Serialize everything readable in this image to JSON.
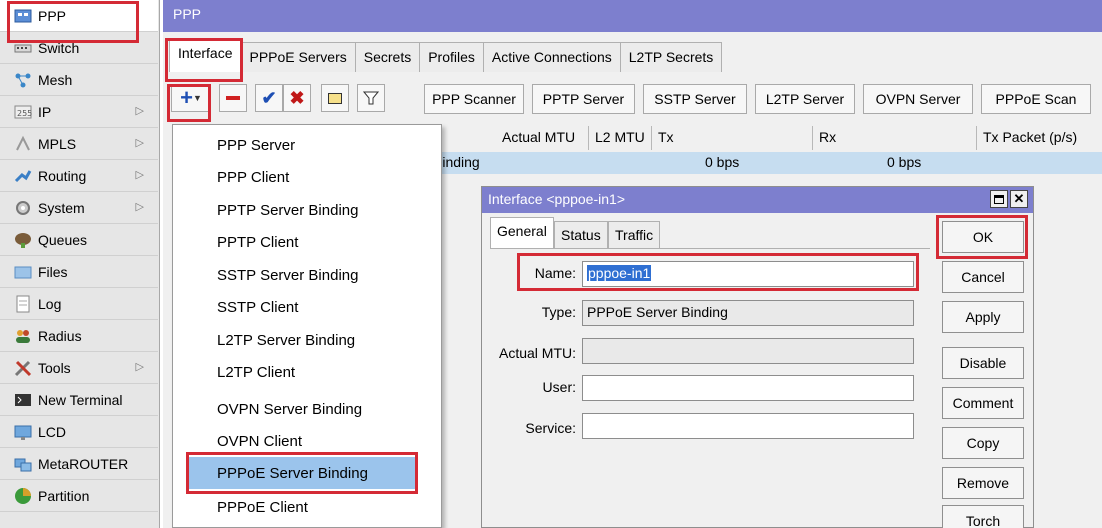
{
  "sidebar": {
    "items": [
      {
        "label": "PPP",
        "icon": "ppp-icon"
      },
      {
        "label": "Switch",
        "icon": "switch-icon"
      },
      {
        "label": "Mesh",
        "icon": "mesh-icon"
      },
      {
        "label": "IP",
        "icon": "ip-icon"
      },
      {
        "label": "MPLS",
        "icon": "mpls-icon"
      },
      {
        "label": "Routing",
        "icon": "routing-icon"
      },
      {
        "label": "System",
        "icon": "system-icon"
      },
      {
        "label": "Queues",
        "icon": "queues-icon"
      },
      {
        "label": "Files",
        "icon": "files-icon"
      },
      {
        "label": "Log",
        "icon": "log-icon"
      },
      {
        "label": "Radius",
        "icon": "radius-icon"
      },
      {
        "label": "Tools",
        "icon": "tools-icon"
      },
      {
        "label": "New Terminal",
        "icon": "terminal-icon"
      },
      {
        "label": "LCD",
        "icon": "lcd-icon"
      },
      {
        "label": "MetaROUTER",
        "icon": "metarouter-icon"
      },
      {
        "label": "Partition",
        "icon": "partition-icon"
      }
    ]
  },
  "window": {
    "title": "PPP"
  },
  "tabs": [
    "Interface",
    "PPPoE Servers",
    "Secrets",
    "Profiles",
    "Active Connections",
    "L2TP Secrets"
  ],
  "toolbar": {
    "scan_buttons": [
      "PPP Scanner",
      "PPTP Server",
      "SSTP Server",
      "L2TP Server",
      "OVPN Server",
      "PPPoE Scan"
    ]
  },
  "table": {
    "columns": [
      "Actual MTU",
      "L2 MTU",
      "Tx",
      "Rx",
      "Tx Packet (p/s)"
    ],
    "row": {
      "type": "Binding",
      "tx": "0 bps",
      "rx": "0 bps"
    }
  },
  "menu": {
    "items": [
      "PPP Server",
      "PPP Client",
      "PPTP Server Binding",
      "PPTP Client",
      "SSTP Server Binding",
      "SSTP Client",
      "L2TP Server Binding",
      "L2TP Client",
      "OVPN Server Binding",
      "OVPN Client",
      "PPPoE Server Binding",
      "PPPoE Client"
    ],
    "selected": "PPPoE Server Binding"
  },
  "dialog": {
    "title": "Interface <pppoe-in1>",
    "tabs": [
      "General",
      "Status",
      "Traffic"
    ],
    "fields": {
      "name_label": "Name:",
      "name_value": "pppoe-in1",
      "type_label": "Type:",
      "type_value": "PPPoE Server Binding",
      "mtu_label": "Actual MTU:",
      "mtu_value": "",
      "user_label": "User:",
      "user_value": "",
      "service_label": "Service:",
      "service_value": ""
    },
    "buttons": [
      "OK",
      "Cancel",
      "Apply",
      "Disable",
      "Comment",
      "Copy",
      "Remove",
      "Torch"
    ]
  },
  "colors": {
    "title_bar": "#7d7fce",
    "highlight": "#d42a35",
    "selection": "#9bc4ec"
  }
}
